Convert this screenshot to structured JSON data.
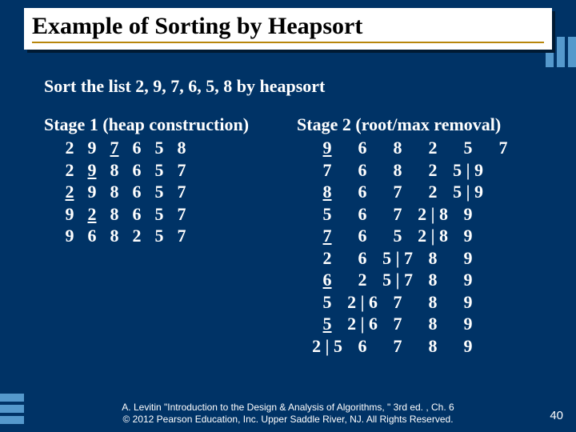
{
  "title": "Example of Sorting by Heapsort",
  "prompt": "Sort the list  2,  9,  7,  6,  5,  8  by heapsort",
  "stage1_heading": "Stage 1 (heap construction)",
  "stage2_heading": "Stage 2 (root/max removal)",
  "stage1": {
    "rows": [
      [
        "2",
        "9",
        "7",
        "6",
        "5",
        "8"
      ],
      [
        "2",
        "9",
        "8",
        "6",
        "5",
        "7"
      ],
      [
        "2",
        "9",
        "8",
        "6",
        "5",
        "7"
      ],
      [
        "9",
        "2",
        "8",
        "6",
        "5",
        "7"
      ],
      [
        "9",
        "6",
        "8",
        "2",
        "5",
        "7"
      ]
    ],
    "underline": [
      2,
      1,
      0,
      1,
      null
    ]
  },
  "stage2": {
    "rows": [
      [
        "9",
        "6",
        "8",
        "2",
        "5",
        "7"
      ],
      [
        "7",
        "6",
        "8",
        "2",
        "5 | 9",
        ""
      ],
      [
        "8",
        "6",
        "7",
        "2",
        "5 | 9",
        ""
      ],
      [
        "5",
        "6",
        "7",
        "2 | 8",
        "9",
        ""
      ],
      [
        "7",
        "6",
        "5",
        "2 | 8",
        "9",
        ""
      ],
      [
        "2",
        "6",
        "5 | 7",
        "8",
        "9",
        ""
      ],
      [
        "6",
        "2",
        "5 | 7",
        "8",
        "9",
        ""
      ],
      [
        "5",
        "2 | 6",
        "7",
        "8",
        "9",
        ""
      ],
      [
        "5",
        "2 | 6",
        "7",
        "8",
        "9",
        ""
      ],
      [
        "2 | 5",
        "6",
        "7",
        "8",
        "9",
        ""
      ]
    ],
    "underline": [
      0,
      null,
      0,
      null,
      0,
      null,
      0,
      null,
      0,
      null
    ]
  },
  "footer1": "A. Levitin \"Introduction to the Design & Analysis of Algorithms, \" 3rd ed. , Ch. 6",
  "footer2": "© 2012 Pearson Education, Inc. Upper Saddle River, NJ. All Rights Reserved.",
  "page": "40"
}
